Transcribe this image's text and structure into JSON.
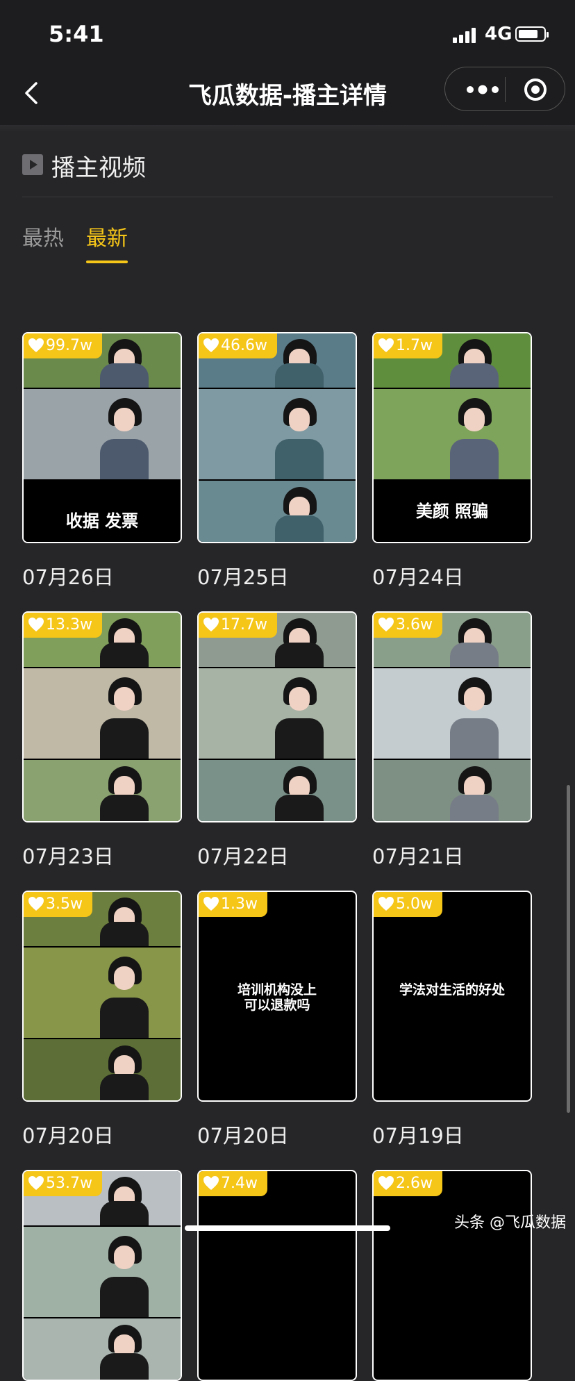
{
  "status": {
    "time": "5:41",
    "network": "4G",
    "battery_fraction": 0.8
  },
  "nav": {
    "title": "飞瓜数据-播主详情",
    "icons": [
      "back-chevron",
      "more-dots",
      "target-circle"
    ]
  },
  "section": {
    "title": "播主视频",
    "icon": "play-icon"
  },
  "tabs": [
    {
      "label": "最热",
      "active": false
    },
    {
      "label": "最新",
      "active": true
    }
  ],
  "colors": {
    "accent": "#f5c518",
    "background": "#262628",
    "header": "#1d1d1f"
  },
  "videos": [
    {
      "likes": "99.7w",
      "caption": "收据 发票",
      "date": "07月26日"
    },
    {
      "likes": "46.6w",
      "caption": "",
      "date": "07月25日"
    },
    {
      "likes": "1.7w",
      "caption": "美颜 照骗",
      "date": "07月24日"
    },
    {
      "likes": "13.3w",
      "caption": "",
      "date": "07月23日"
    },
    {
      "likes": "17.7w",
      "caption": "",
      "date": "07月22日"
    },
    {
      "likes": "3.6w",
      "caption": "",
      "date": "07月21日"
    },
    {
      "likes": "3.5w",
      "caption": "",
      "date": "07月20日"
    },
    {
      "likes": "1.3w",
      "text": "培训机构没上\n可以退款吗",
      "date": "07月20日"
    },
    {
      "likes": "5.0w",
      "text": "学法对生活的好处",
      "date": "07月19日"
    },
    {
      "likes": "53.7w",
      "caption": "",
      "date": ""
    },
    {
      "likes": "7.4w",
      "caption": "",
      "date": ""
    },
    {
      "likes": "2.6w",
      "caption": "",
      "date": ""
    }
  ],
  "watermark": "头条 @飞瓜数据"
}
